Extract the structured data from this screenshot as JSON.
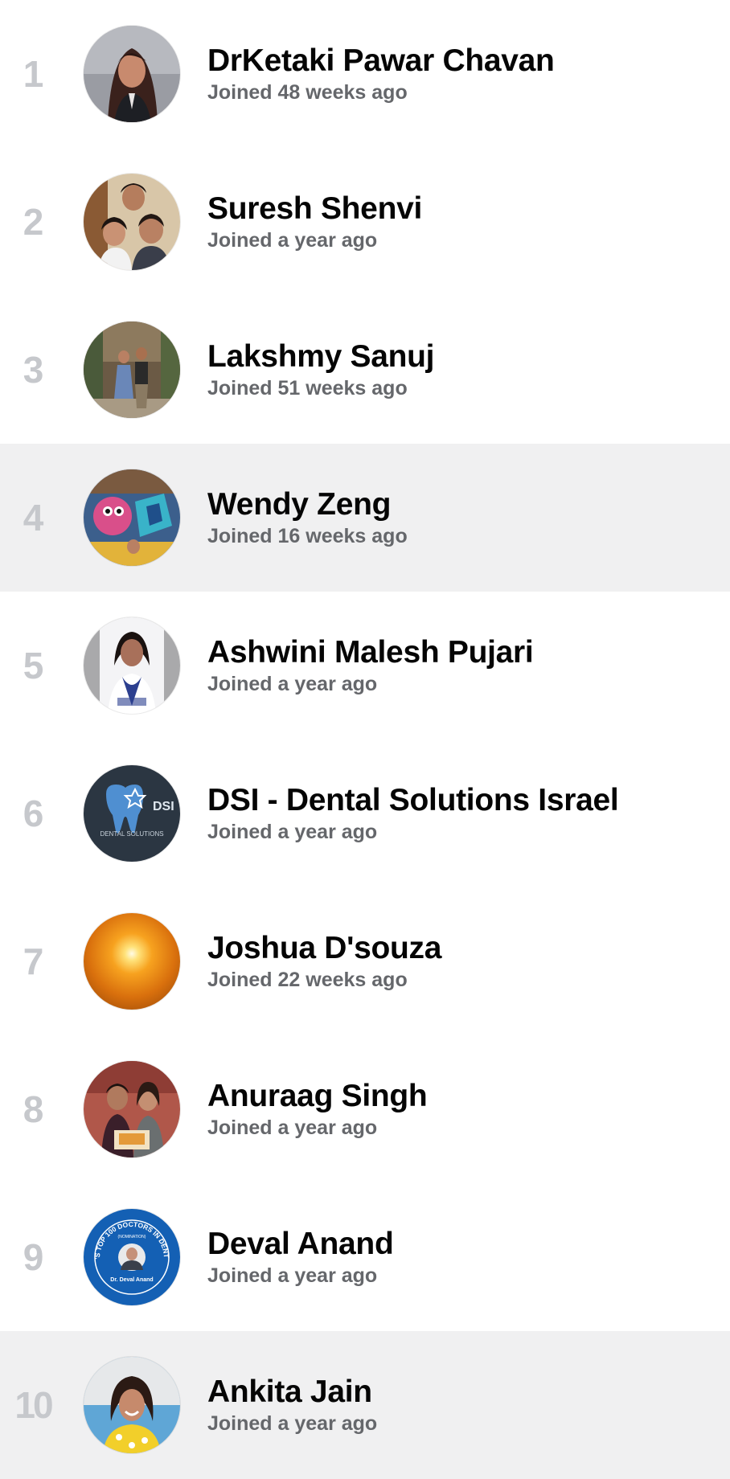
{
  "members": [
    {
      "rank": "1",
      "name": "DrKetaki Pawar Chavan",
      "joined": "Joined 48 weeks ago",
      "avatar_icon": "woman-portrait-photo",
      "highlighted": false
    },
    {
      "rank": "2",
      "name": "Suresh Shenvi",
      "joined": "Joined a year ago",
      "avatar_icon": "family-photo",
      "highlighted": false
    },
    {
      "rank": "3",
      "name": "Lakshmy Sanuj",
      "joined": "Joined 51 weeks ago",
      "avatar_icon": "couple-photo",
      "highlighted": false
    },
    {
      "rank": "4",
      "name": "Wendy Zeng",
      "joined": "Joined 16 weeks ago",
      "avatar_icon": "graffiti-photo",
      "highlighted": true
    },
    {
      "rank": "5",
      "name": "Ashwini Malesh Pujari",
      "joined": "Joined a year ago",
      "avatar_icon": "doctor-portrait-photo",
      "highlighted": false
    },
    {
      "rank": "6",
      "name": "DSI - Dental Solutions Israel",
      "joined": "Joined a year ago",
      "avatar_icon": "dental-logo",
      "highlighted": false
    },
    {
      "rank": "7",
      "name": "Joshua D'souza",
      "joined": "Joined 22 weeks ago",
      "avatar_icon": "sun-photo",
      "highlighted": false
    },
    {
      "rank": "8",
      "name": "Anuraag Singh",
      "joined": "Joined a year ago",
      "avatar_icon": "couple-photo",
      "highlighted": false
    },
    {
      "rank": "9",
      "name": "Deval Anand",
      "joined": "Joined a year ago",
      "avatar_icon": "badge-logo",
      "highlighted": false
    },
    {
      "rank": "10",
      "name": "Ankita Jain",
      "joined": "Joined a year ago",
      "avatar_icon": "woman-portrait-photo",
      "highlighted": true
    }
  ],
  "avatar_logo_text": {
    "dsi_mark": "DSI",
    "dsi_caption": "DENTAL SOLUTIONS",
    "badge_ring": "INDIA'S TOP 100 DOCTORS IN DENTISTRY",
    "badge_sub": "(NOMINATION)",
    "badge_name": "Dr. Deval Anand"
  },
  "colors": {
    "highlight_bg": "#f0f0f1",
    "rank_text": "#c6c8cc",
    "name_text": "#050505",
    "secondary_text": "#65676b"
  }
}
